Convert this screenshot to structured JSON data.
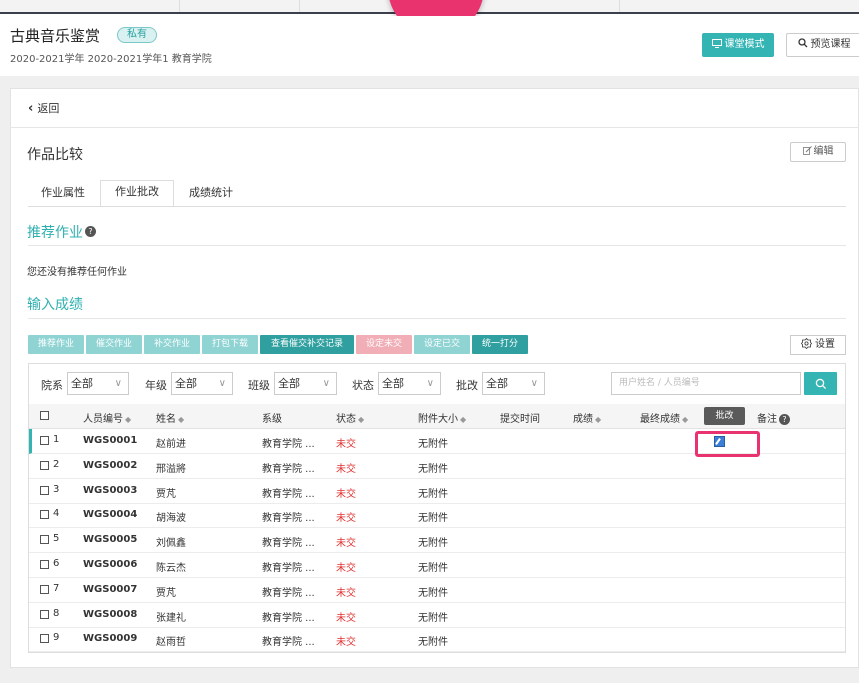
{
  "course": {
    "title": "古典音乐鉴赏",
    "badge": "私有",
    "subtitle": "2020-2021学年 2020-2021学年1 教育学院",
    "classroom_mode": "课堂模式",
    "preview": "预览课程"
  },
  "nav": {
    "back": "返回"
  },
  "page": {
    "heading": "作品比较",
    "edit": "编辑"
  },
  "tabs": [
    {
      "label": "作业属性"
    },
    {
      "label": "作业批改"
    },
    {
      "label": "成绩统计"
    }
  ],
  "recommend": {
    "title": "推荐作业",
    "empty": "您还没有推荐任何作业"
  },
  "score_input": {
    "title": "输入成绩"
  },
  "actions": [
    {
      "label": "推荐作业"
    },
    {
      "label": "催交作业"
    },
    {
      "label": "补交作业"
    },
    {
      "label": "打包下载"
    },
    {
      "label": "查看催交补交记录"
    },
    {
      "label": "设定未交"
    },
    {
      "label": "设定已交"
    },
    {
      "label": "统一打分"
    }
  ],
  "settings": "设置",
  "filters": [
    {
      "label": "院系",
      "value": "全部"
    },
    {
      "label": "年级",
      "value": "全部"
    },
    {
      "label": "班级",
      "value": "全部"
    },
    {
      "label": "状态",
      "value": "全部"
    },
    {
      "label": "批改",
      "value": "全部"
    }
  ],
  "search": {
    "placeholder": "用户姓名 / 人员编号"
  },
  "columns": {
    "id": "人员编号",
    "name": "姓名",
    "dept": "系级",
    "status": "状态",
    "attach": "附件大小",
    "submit_time": "提交时间",
    "score": "成绩",
    "final": "最终成绩",
    "note": "备注"
  },
  "tooltip": "批改",
  "rows": [
    {
      "no": "1",
      "id": "WGS0001",
      "name": "赵前进",
      "dept": "教育学院 ...",
      "status": "未交",
      "attach": "无附件"
    },
    {
      "no": "2",
      "id": "WGS0002",
      "name": "邢溢將",
      "dept": "教育学院 ...",
      "status": "未交",
      "attach": "无附件"
    },
    {
      "no": "3",
      "id": "WGS0003",
      "name": "贾芃",
      "dept": "教育学院 ...",
      "status": "未交",
      "attach": "无附件"
    },
    {
      "no": "4",
      "id": "WGS0004",
      "name": "胡海波",
      "dept": "教育学院 ...",
      "status": "未交",
      "attach": "无附件"
    },
    {
      "no": "5",
      "id": "WGS0005",
      "name": "刘佩鑫",
      "dept": "教育学院 ...",
      "status": "未交",
      "attach": "无附件"
    },
    {
      "no": "6",
      "id": "WGS0006",
      "name": "陈云杰",
      "dept": "教育学院 ...",
      "status": "未交",
      "attach": "无附件"
    },
    {
      "no": "7",
      "id": "WGS0007",
      "name": "贾芃",
      "dept": "教育学院 ...",
      "status": "未交",
      "attach": "无附件"
    },
    {
      "no": "8",
      "id": "WGS0008",
      "name": "张建礼",
      "dept": "教育学院 ...",
      "status": "未交",
      "attach": "无附件"
    },
    {
      "no": "9",
      "id": "WGS0009",
      "name": "赵雨哲",
      "dept": "教育学院 ...",
      "status": "未交",
      "attach": "无附件"
    }
  ],
  "colors": {
    "accent": "#35b4b4",
    "action_light": "#8fd3d3",
    "action_dark": "#2f9f9f",
    "action_pink": "#f2aeb6",
    "status_red": "#e03131",
    "highlight": "#e8336f"
  },
  "icons": [
    "back-chevron-icon",
    "help-icon",
    "monitor-icon",
    "search-icon",
    "edit-icon",
    "gear-icon",
    "grade-edit-icon",
    "chevron-down-icon"
  ]
}
